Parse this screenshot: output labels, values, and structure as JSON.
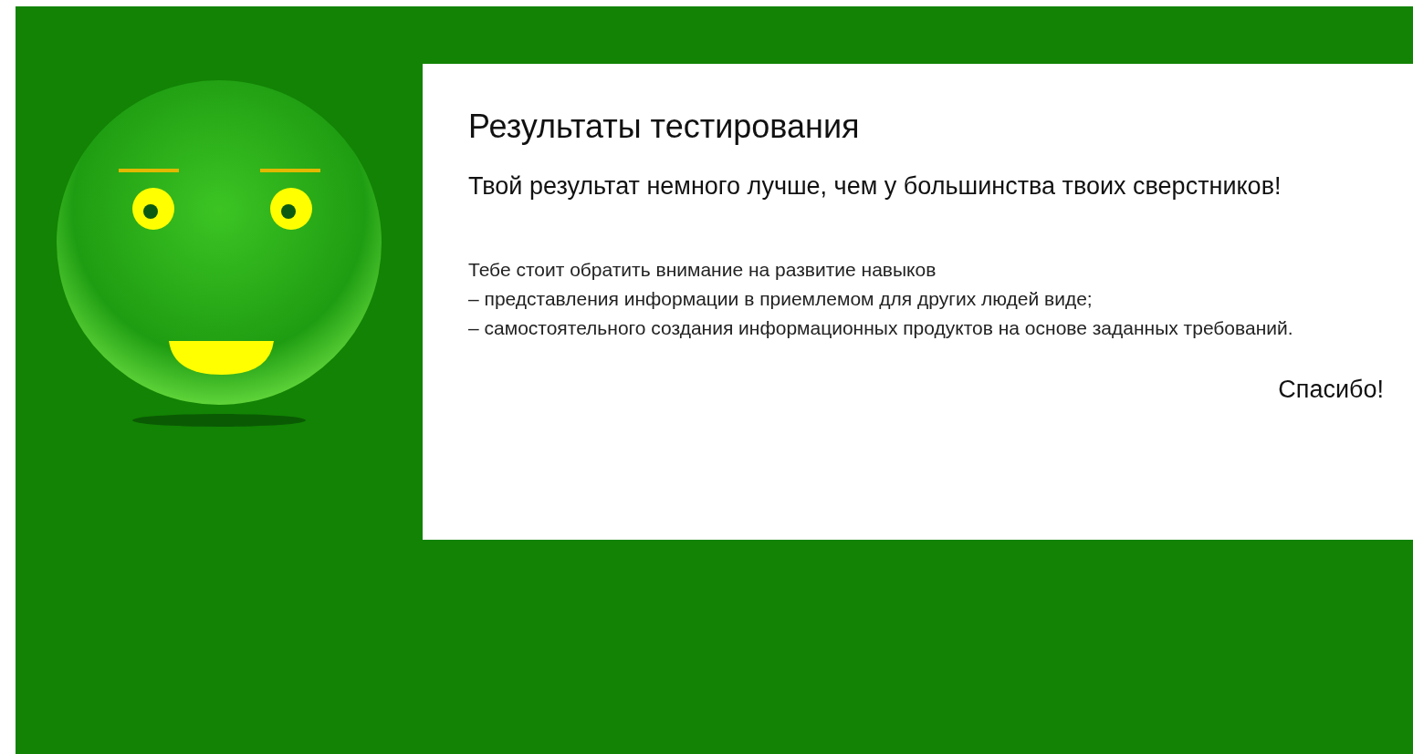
{
  "card": {
    "title": "Результаты тестирования",
    "result": "Твой результат немного лучше, чем у большинства твоих сверстников!",
    "advice_intro": "Тебе стоит обратить внимание на развитие навыков",
    "advice_items": [
      "– представления информации в приемлемом для других людей виде;",
      "– самостоятельного создания информационных продуктов на основе заданных требований."
    ],
    "thanks": "Спасибо!"
  }
}
